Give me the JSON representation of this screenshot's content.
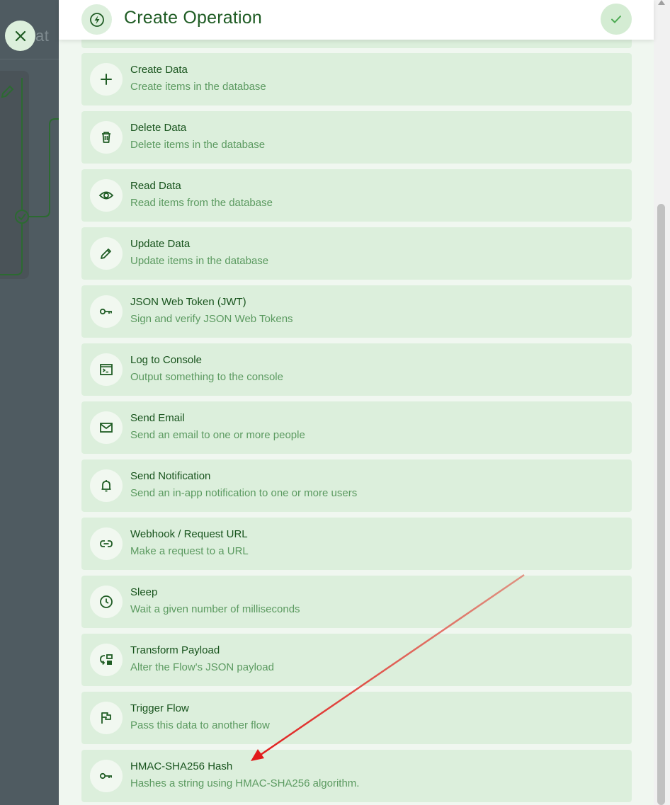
{
  "background": {
    "title_fragment": "at",
    "close_icon": "close-icon"
  },
  "drawer": {
    "title": "Create Operation",
    "title_icon": "bolt-circle-icon",
    "confirm_icon": "check-icon"
  },
  "operations": [
    {
      "title": "Create Data",
      "description": "Create items in the database",
      "icon": "plus-icon"
    },
    {
      "title": "Delete Data",
      "description": "Delete items in the database",
      "icon": "trash-icon"
    },
    {
      "title": "Read Data",
      "description": "Read items from the database",
      "icon": "eye-icon"
    },
    {
      "title": "Update Data",
      "description": "Update items in the database",
      "icon": "pencil-icon"
    },
    {
      "title": "JSON Web Token (JWT)",
      "description": "Sign and verify JSON Web Tokens",
      "icon": "key-icon"
    },
    {
      "title": "Log to Console",
      "description": "Output something to the console",
      "icon": "terminal-icon"
    },
    {
      "title": "Send Email",
      "description": "Send an email to one or more people",
      "icon": "mail-icon"
    },
    {
      "title": "Send Notification",
      "description": "Send an in-app notification to one or more users",
      "icon": "bell-icon"
    },
    {
      "title": "Webhook / Request URL",
      "description": "Make a request to a URL",
      "icon": "link-icon"
    },
    {
      "title": "Sleep",
      "description": "Wait a given number of milliseconds",
      "icon": "clock-icon"
    },
    {
      "title": "Transform Payload",
      "description": "Alter the Flow's JSON payload",
      "icon": "transform-icon"
    },
    {
      "title": "Trigger Flow",
      "description": "Pass this data to another flow",
      "icon": "flag-icon"
    },
    {
      "title": "HMAC-SHA256 Hash",
      "description": "Hashes a string using HMAC-SHA256 algorithm.",
      "icon": "key-icon"
    }
  ],
  "colors": {
    "accent": "#1f5c24",
    "item_background": "#dcefdc",
    "annotation_arrow": "#e02020"
  }
}
